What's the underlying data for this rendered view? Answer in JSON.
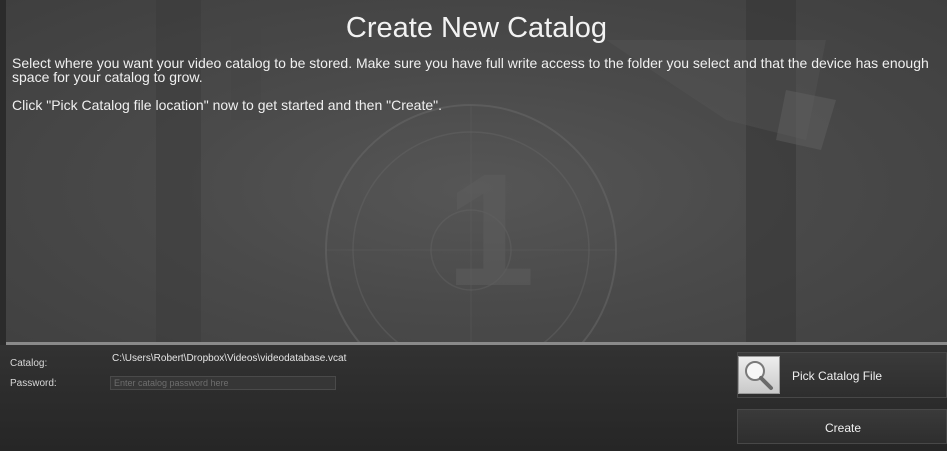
{
  "header": {
    "title": "Create New Catalog"
  },
  "instructions": {
    "line1": "Select where you want your video catalog to be stored. Make sure you have full write access to the folder you select and that the device has enough space for your catalog to grow.",
    "line2": "Click \"Pick Catalog file location\" now to get started and then \"Create\"."
  },
  "form": {
    "catalog_label": "Catalog:",
    "catalog_path": "C:\\Users\\Robert\\Dropbox\\Videos\\videodatabase.vcat",
    "password_label": "Password:",
    "password_value": "",
    "password_placeholder": "Enter catalog password here"
  },
  "buttons": {
    "pick_label": "Pick Catalog File",
    "pick_icon": "magnifier-icon",
    "create_label": "Create"
  },
  "backdrop": {
    "countdown_digit": "1"
  }
}
